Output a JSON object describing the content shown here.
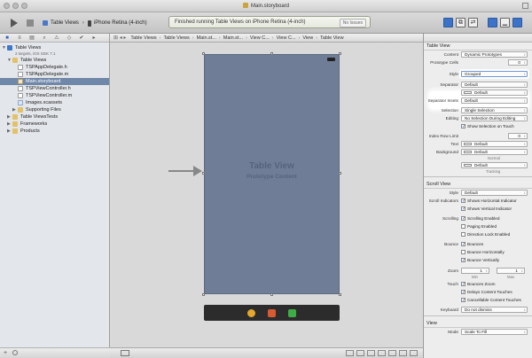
{
  "window": {
    "title": "Main.storyboard"
  },
  "toolbar": {
    "scheme_target": "Table Views",
    "scheme_device": "iPhone Retina (4-inch)",
    "activity_text": "Finished running Table Views on iPhone Retina (4-inch)",
    "issues_label": "No Issues",
    "editor_glyphs": [
      "≡",
      "⧉",
      "⇄"
    ],
    "view_glyphs": [
      "▏",
      "▁",
      "▕"
    ],
    "colors": {
      "accent": "#3c73c8"
    }
  },
  "navigator": {
    "tab_glyphs": [
      "■",
      "≡",
      "▤",
      "⌕",
      "⚠",
      "◇",
      "✔",
      "▸"
    ],
    "items": [
      {
        "label": "Table Views",
        "sub": "2 targets, iOS SDK 7.1"
      },
      {
        "label": "Table Views"
      },
      {
        "label": "TSPAppDelegate.h"
      },
      {
        "label": "TSPAppDelegate.m"
      },
      {
        "label": "Main.storyboard"
      },
      {
        "label": "TSPViewController.h"
      },
      {
        "label": "TSPViewController.m"
      },
      {
        "label": "Images.xcassets"
      },
      {
        "label": "Supporting Files"
      },
      {
        "label": "Table ViewsTests"
      },
      {
        "label": "Frameworks"
      },
      {
        "label": "Products"
      }
    ]
  },
  "jumpbar": {
    "crumbs": [
      "Table Views",
      "Table Views",
      "Main.st...",
      "Main.st...",
      "View C...",
      "View C...",
      "View",
      "Table View"
    ]
  },
  "canvas": {
    "scene_title": "Table View",
    "scene_subtitle": "Prototype Content"
  },
  "inspector": {
    "table_view": {
      "section_title": "Table View",
      "content_label": "Content",
      "content_value": "Dynamic Prototypes",
      "prototype_cells_label": "Prototype Cells",
      "prototype_cells_value": "0",
      "style_label": "Style",
      "style_value": "Grouped",
      "separator_label": "Separator",
      "separator_value": "Default",
      "separator_color_value": "Default",
      "separator_insets_label": "Separator Insets",
      "separator_insets_value": "Default",
      "selection_label": "Selection",
      "selection_value": "Single Selection",
      "editing_label": "Editing",
      "editing_value": "No Selection During Editing",
      "show_selection_label": "Show Selection on Touch",
      "index_row_limit_label": "Index Row Limit",
      "index_row_limit_value": "0",
      "text_label": "Text",
      "text_value": "Default",
      "background_label": "Background",
      "background_value": "Default",
      "normal_caption": "Normal",
      "tracking_value": "Default",
      "tracking_caption": "Tracking"
    },
    "scroll_view": {
      "section_title": "Scroll View",
      "style_label": "Style",
      "style_value": "Default",
      "indicators_label": "Scroll Indicators",
      "show_horizontal_label": "Shows Horizontal Indicator",
      "show_vertical_label": "Shows Vertical Indicator",
      "scrolling_label": "Scrolling",
      "scrolling_enabled_label": "Scrolling Enabled",
      "paging_label": "Paging Enabled",
      "direction_lock_label": "Direction Lock Enabled",
      "bounce_label": "Bounce",
      "bounces_label": "Bounces",
      "bounce_h_label": "Bounce Horizontally",
      "bounce_v_label": "Bounce Vertically",
      "zoom_label": "Zoom",
      "zoom_min": "1",
      "zoom_max": "1",
      "min_caption": "Min",
      "max_caption": "Max",
      "touch_label": "Touch",
      "bounces_zoom_label": "Bounces Zoom",
      "delays_touches_label": "Delays Content Touches",
      "cancellable_touches_label": "Cancellable Content Touches",
      "keyboard_label": "Keyboard",
      "keyboard_value": "Do not dismiss"
    },
    "view": {
      "section_title": "View",
      "mode_label": "Mode",
      "mode_value": "Scale To Fill"
    }
  }
}
